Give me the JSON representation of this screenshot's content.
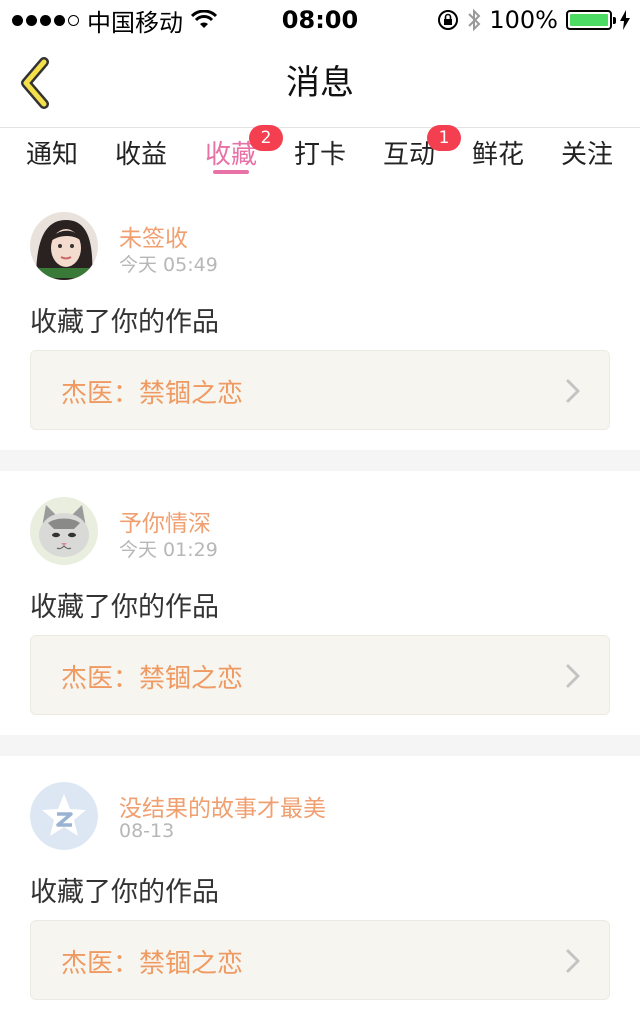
{
  "status_bar": {
    "carrier": "中国移动",
    "time": "08:00",
    "battery_percent": "100%",
    "battery_level": 1.0,
    "battery_color": "#4cd964"
  },
  "nav": {
    "title": "消息",
    "back_icon": "chevron-left-icon",
    "back_color": "#f3e04a"
  },
  "tabs": [
    {
      "label": "通知",
      "badge": ""
    },
    {
      "label": "收益",
      "badge": ""
    },
    {
      "label": "收藏",
      "badge": "2",
      "active": true
    },
    {
      "label": "打卡",
      "badge": ""
    },
    {
      "label": "互动",
      "badge": "1"
    },
    {
      "label": "鲜花",
      "badge": ""
    },
    {
      "label": "关注",
      "badge": ""
    }
  ],
  "colors": {
    "accent": "#e871a6",
    "badge": "#f33f4f",
    "username": "#f0a070",
    "work_title": "#ef9a62",
    "card_bg": "#f6f5ef"
  },
  "messages": [
    {
      "user": "未签收",
      "time": "今天 05:49",
      "action": "收藏了你的作品",
      "work": "杰医：禁锢之恋",
      "avatar": "avatar-girl"
    },
    {
      "user": "予你情深",
      "time": "今天 01:29",
      "action": "收藏了你的作品",
      "work": "杰医：禁锢之恋",
      "avatar": "avatar-cat"
    },
    {
      "user": "没结果的故事才最美",
      "time": "08-13",
      "action": "收藏了你的作品",
      "work": "杰医：禁锢之恋",
      "avatar": "avatar-default-star"
    }
  ]
}
